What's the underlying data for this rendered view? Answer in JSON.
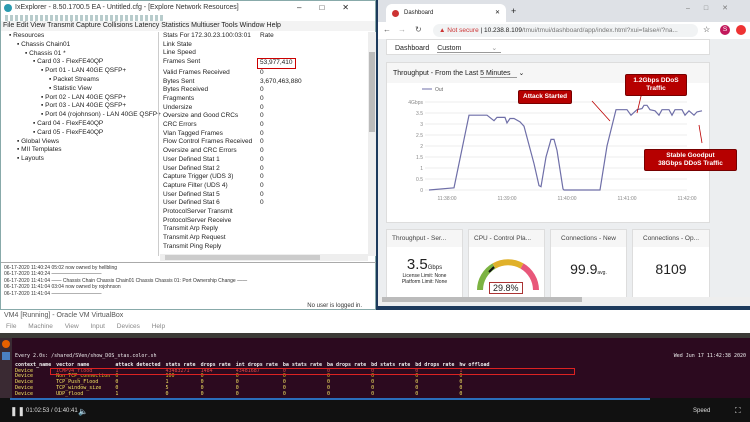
{
  "ixexplorer": {
    "title": "IxExplorer - 8.50.1700.5 EA - Untitled.cfg - [Explore Network Resources]",
    "menu": "File Edit View Transmit Capture Collisions Latency Statistics Multiuser Tools Window Help",
    "tree": [
      "Resources",
      "Chassis Chain01",
      "Chassis 01 *",
      "Card 03 - FlexFE40QP",
      "Port 01  - LAN 40GE QSFP+",
      "Packet Streams",
      "Statistic View",
      "Port 02  - LAN 40GE QSFP+",
      "Port 03  - LAN 40GE QSFP+",
      "Port 04  (rojohnson)  - LAN 40GE QSFP+",
      "Card 04 - FlexFE40QP",
      "Card 05 - FlexFE40QP",
      "Global Views",
      "MII Templates",
      "Layouts"
    ],
    "stats_header": "Stats For 172.30.23.100:03:01",
    "rate_header": "Rate",
    "stats": [
      [
        "Link State",
        ""
      ],
      [
        "Line Speed",
        ""
      ],
      [
        "Frames Sent",
        "53,977,410"
      ],
      [
        "Valid Frames Received",
        "0"
      ],
      [
        "Bytes Sent",
        "3,670,463,880"
      ],
      [
        "Bytes Received",
        "0"
      ],
      [
        "Fragments",
        "0"
      ],
      [
        "Undersize",
        "0"
      ],
      [
        "Oversize and Good CRCs",
        "0"
      ],
      [
        "CRC Errors",
        "0"
      ],
      [
        "Vlan Tagged Frames",
        "0"
      ],
      [
        "Flow Control Frames Received",
        "0"
      ],
      [
        "Oversize and CRC Errors",
        "0"
      ],
      [
        "User Defined Stat 1",
        "0"
      ],
      [
        "User Defined Stat 2",
        "0"
      ],
      [
        "Capture Trigger (UDS 3)",
        "0"
      ],
      [
        "Capture Filter (UDS 4)",
        "0"
      ],
      [
        "User Defined Stat 5",
        "0"
      ],
      [
        "User Defined Stat 6",
        "0"
      ],
      [
        "ProtocolServer Transmit",
        ""
      ],
      [
        "ProtocolServer Receive",
        ""
      ],
      [
        "Transmit Arp Reply",
        ""
      ],
      [
        "Transmit Arp Request",
        ""
      ],
      [
        "Transmit Ping Reply",
        ""
      ]
    ],
    "log": [
      "06-17-2020 11:40:24 05:02 now owned by hellbling",
      "06-17-2020 11:40:24 ——————————",
      "06-17-2020 11:41:04 ——  Chassis Chain Chassis Chain01 Chassis Chassis 01: Port Ownership Change  ——",
      "06-17-2020 11:41:04 03:04 now owned by rojohnson",
      "06-17-2020 11:41:04 ——————————"
    ],
    "status": "No user is logged in."
  },
  "browser": {
    "tab": "Dashboard",
    "not_secure": "Not secure",
    "url_host": "10.238.8.109",
    "url_path": "/tmui/tmui/dashboard/app/index.html?xui=false#/?na...",
    "avatar": "S",
    "dashboard_label": "Dashboard",
    "dashboard_value": "Custom",
    "throughput_title": "Throughput - From the Last",
    "range": "5 Minutes",
    "legend": "Out",
    "annotations": {
      "attack": "Attack Started",
      "ddos": "1.2Gbps DDoS Traffic",
      "stable1": "Stable Goodput",
      "stable2": "38Gbps DDoS Traffic"
    },
    "cards": {
      "tp_title": "Throughput - Ser...",
      "tp_value": "3.5",
      "tp_unit": "Gbps",
      "license": "License Limit: None",
      "platform": "Platform Limit: None",
      "cpu_title": "CPU - Control Pla...",
      "cpu_value": "29.8%",
      "cpu_pct": 29.8,
      "conn_new_title": "Connections - New",
      "conn_new_value": "99.9",
      "conn_new_unit": "avg.",
      "conn_open_title": "Connections - Op...",
      "conn_open_value": "8109"
    }
  },
  "chart_data": {
    "type": "line",
    "title": "Throughput - From the Last 5 Minutes",
    "series": [
      {
        "name": "Out",
        "x_seconds_after_11_38_00": [
          -18,
          7,
          22,
          40,
          47,
          50,
          58,
          60,
          63,
          67,
          73,
          77,
          87,
          92,
          94,
          99,
          104,
          107,
          110,
          116,
          117,
          153,
          160,
          169,
          180,
          184,
          190,
          195,
          197,
          200,
          203,
          208,
          212,
          215,
          222,
          225,
          228,
          235,
          238,
          242,
          247,
          250,
          255
        ],
        "values": [
          0,
          0.1,
          3.4,
          3.4,
          3.15,
          3.3,
          3.3,
          3.05,
          3.25,
          3.25,
          3.1,
          2.9,
          1.2,
          0.2,
          0.15,
          1.5,
          2.3,
          2.3,
          1.8,
          0.05,
          0,
          0,
          2.0,
          3.65,
          3.65,
          3.4,
          3.65,
          3.7,
          3.85,
          3.85,
          3.65,
          3.6,
          3.4,
          3.65,
          3.65,
          3.4,
          3.65,
          3.65,
          3.4,
          3.6,
          3.4,
          3.55,
          3.6
        ]
      }
    ],
    "yticks": [
      "0",
      "0.5",
      "1",
      "1.5",
      "2",
      "2.5",
      "3",
      "3.5",
      "4Gbps"
    ],
    "ylim": [
      0,
      4
    ],
    "xticks": [
      "11:38:00",
      "11:39:00",
      "11:40:00",
      "11:41:00",
      "11:42:00"
    ]
  },
  "vbox": {
    "title": "VM4 [Running] - Oracle VM VirtualBox",
    "menu": [
      "File",
      "Machine",
      "View",
      "Input",
      "Devices",
      "Help"
    ],
    "cmd": "Every 2.0s: /shared/SVen/show_DOS_stas.color.sh",
    "clock": "Wed Jun 17 11:42:38 2020",
    "headers": [
      "context_name",
      "vector name",
      "attack detected",
      "stats rate",
      "drops rate",
      "int drops rate",
      "ba stats rate",
      "ba drops rate",
      "bd stats rate",
      "bd drops rate",
      "hw offload"
    ],
    "rows": [
      [
        "Device",
        "ICMPv4_flood",
        "1",
        "43483271",
        "1484",
        "43481687",
        "0",
        "0",
        "0",
        "0",
        "1"
      ],
      [
        "Device",
        "Non_TCP_connection",
        "0",
        "100",
        "0",
        "0",
        "0",
        "0",
        "0",
        "0",
        "0"
      ],
      [
        "Device",
        "TCP_Push_Flood",
        "0",
        "1",
        "0",
        "0",
        "0",
        "0",
        "0",
        "0",
        "0"
      ],
      [
        "Device",
        "TCP_window_size",
        "0",
        "5",
        "0",
        "0",
        "0",
        "0",
        "0",
        "0",
        "0"
      ],
      [
        "Device",
        "UDP_flood",
        "1",
        "0",
        "0",
        "0",
        "0",
        "0",
        "0",
        "0",
        "0"
      ]
    ],
    "time": "01:02:53 / 01:40:41",
    "speed": "Speed"
  }
}
